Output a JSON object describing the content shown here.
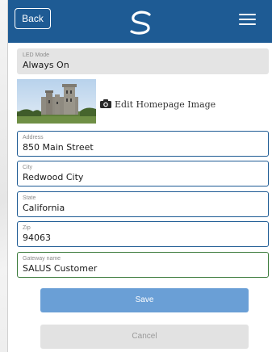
{
  "header": {
    "back_label": "Back"
  },
  "icons": {
    "menu": "hamburger-menu-icon",
    "logo": "salus-logo-icon",
    "camera": "camera-icon"
  },
  "colors": {
    "header_bg": "#1e5b94",
    "save_bg": "#6a9fd6",
    "cancel_bg": "#e2e2e2"
  },
  "led_mode": {
    "label": "LED Mode",
    "value": "Always On"
  },
  "homepage_image": {
    "edit_label": "Edit Homepage Image"
  },
  "fields": {
    "address": {
      "label": "Address",
      "value": "850 Main Street"
    },
    "city": {
      "label": "City",
      "value": "Redwood City"
    },
    "state": {
      "label": "State",
      "value": "California"
    },
    "zip": {
      "label": "Zip",
      "value": "94063"
    },
    "gateway": {
      "label": "Gateway name",
      "value": "SALUS Customer"
    }
  },
  "buttons": {
    "save": "Save",
    "cancel": "Cancel"
  }
}
